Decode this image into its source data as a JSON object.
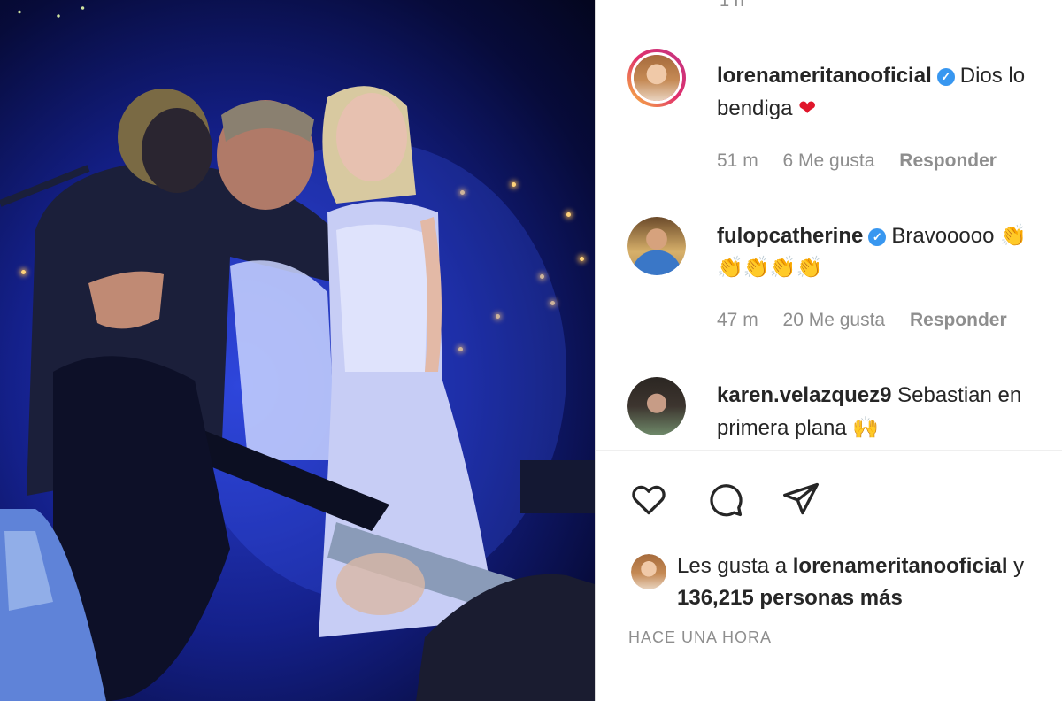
{
  "post": {
    "top_stub": "1 h",
    "comments": [
      {
        "username": "lorenameritanooficial",
        "verified_icon": "✓",
        "text_line1": "Dios lo",
        "text_line2": "bendiga",
        "emoji": "❤",
        "time": "51 m",
        "likes": "6 Me gusta",
        "reply": "Responder",
        "avatar_icon": "avatar-lorena"
      },
      {
        "username": "fulopcatherine",
        "verified_icon": "✓",
        "text_line1": "Bravooooo",
        "line1_emoji": "👏",
        "line2_emoji": "👏👏👏👏",
        "time": "47 m",
        "likes": "20 Me gusta",
        "reply": "Responder",
        "avatar_icon": "avatar-catherine"
      },
      {
        "username": "karen.velazquez9",
        "text_line1": "Sebastian en",
        "text_line2": "primera plana",
        "emoji": "🙌",
        "avatar_icon": "avatar-karen"
      }
    ],
    "actions": {
      "like_icon": "heart-icon",
      "comment_icon": "comment-icon",
      "share_icon": "send-icon"
    },
    "liked_by": {
      "prefix": "Les gusta a",
      "user": "lorenameritanooficial",
      "suffix": "y",
      "count_line": "136,215 personas más"
    },
    "time_ago": "HACE UNA HORA"
  },
  "colors": {
    "verified": "#3897f0",
    "meta_gray": "#8e8e8e",
    "text": "#262626",
    "heart_red": "#e0162b"
  }
}
